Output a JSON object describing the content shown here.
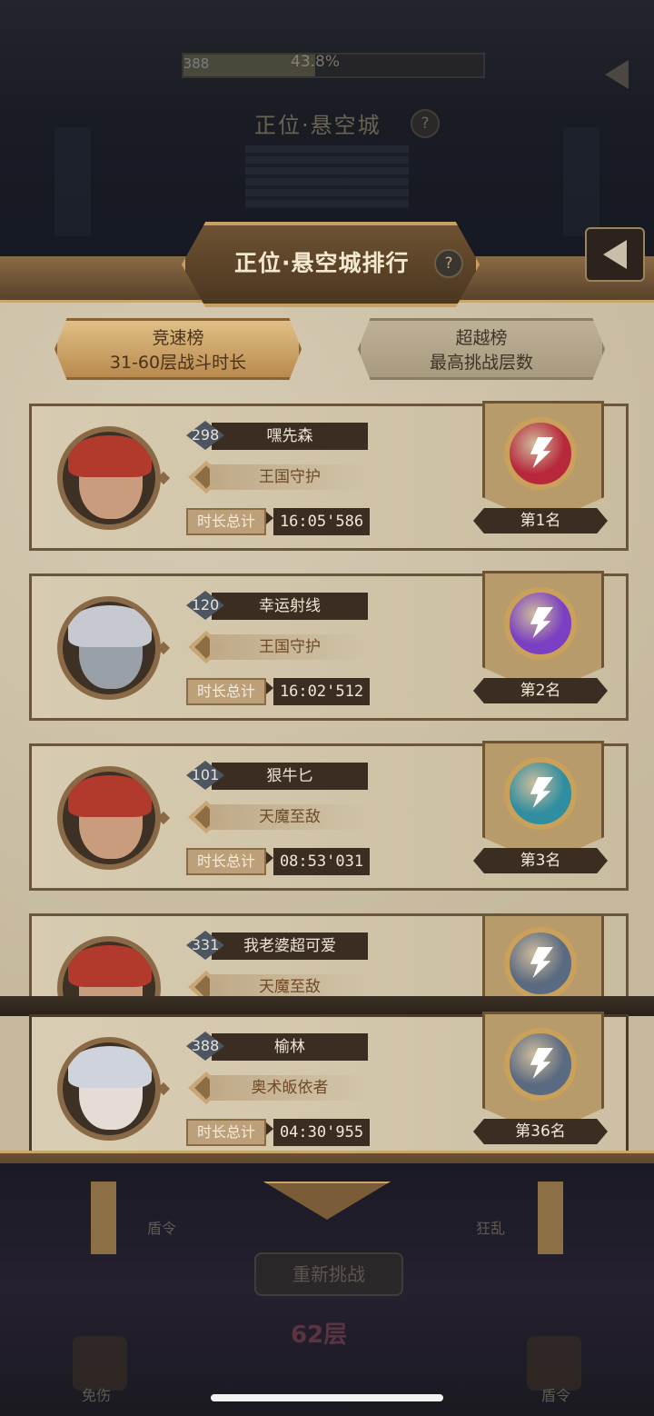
{
  "top_hud": {
    "level": "388",
    "progress_text": "43.8%",
    "progress_fraction": 0.438,
    "stage_title": "正位·悬空城",
    "help": "?"
  },
  "panel": {
    "title": "正位·悬空城排行",
    "help": "?"
  },
  "tabs": [
    {
      "line1": "竞速榜",
      "line2": "31-60层战斗时长",
      "active": true
    },
    {
      "line1": "超越榜",
      "line2": "最高挑战层数",
      "active": false
    }
  ],
  "entries": [
    {
      "level": "298",
      "name": "嘿先森",
      "title": "王国守护",
      "time_label": "时长总计",
      "time": "16:05'586",
      "rank": "第1名",
      "medal_color": "#b8283c"
    },
    {
      "level": "120",
      "name": "幸运射线",
      "title": "王国守护",
      "time_label": "时长总计",
      "time": "16:02'512",
      "rank": "第2名",
      "medal_color": "#7a3fc2"
    },
    {
      "level": "101",
      "name": "狠牛匕",
      "title": "天魔至敌",
      "time_label": "时长总计",
      "time": "08:53'031",
      "rank": "第3名",
      "medal_color": "#2f8ea0"
    },
    {
      "level": "331",
      "name": "我老婆超可爱",
      "title": "天魔至敌",
      "medal_color": "#5a6a80"
    }
  ],
  "self_entry": {
    "level": "388",
    "name": "榆林",
    "title": "奥术皈依者",
    "time_label": "时长总计",
    "time": "04:30'955",
    "rank": "第36名",
    "medal_color": "#5a6a80"
  },
  "bottom": {
    "left_label": "盾令",
    "right_label": "狂乱",
    "retry": "重新挑战",
    "floor": "62层",
    "corner_left": "免伤",
    "corner_right": "盾令"
  }
}
